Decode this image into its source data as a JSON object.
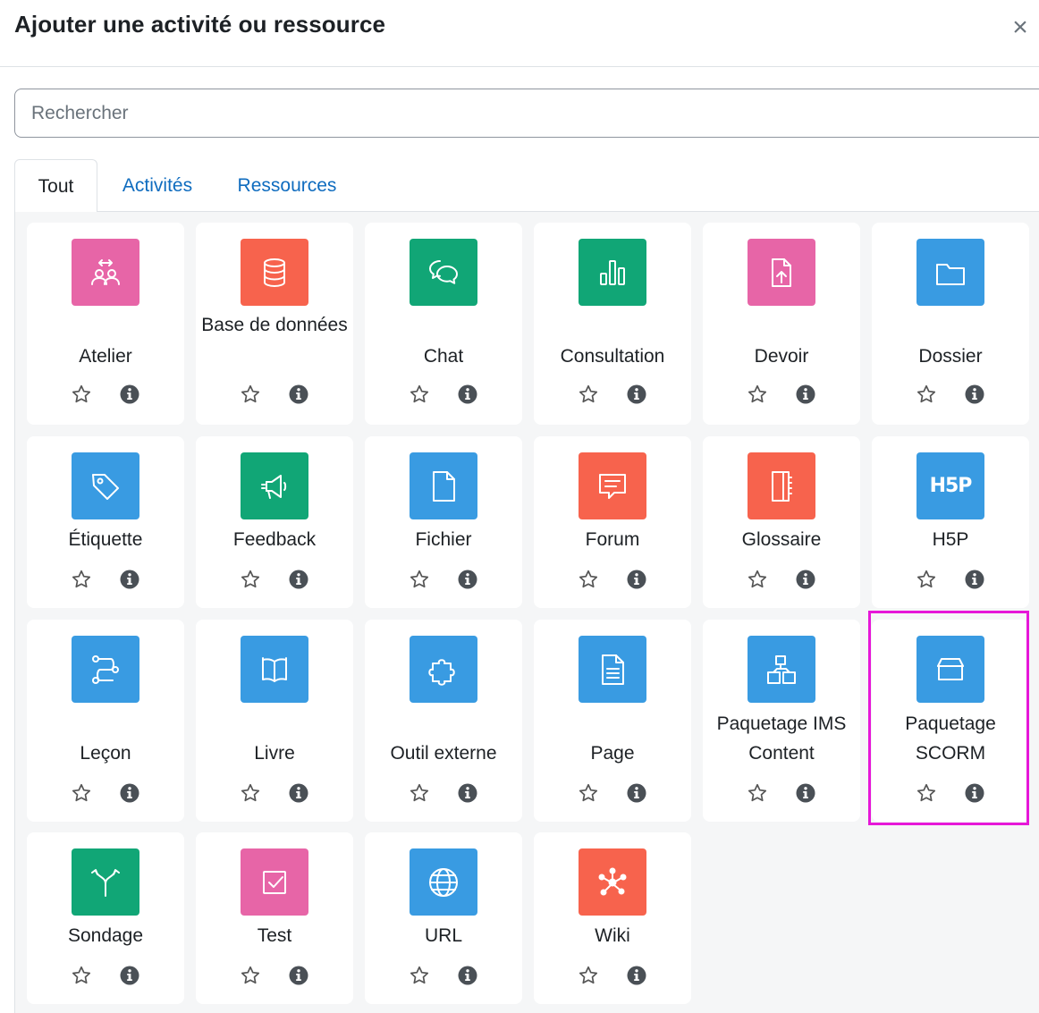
{
  "modal": {
    "title": "Ajouter une activité ou ressource",
    "close_label": "×"
  },
  "search": {
    "placeholder": "Rechercher",
    "value": ""
  },
  "tabs": [
    {
      "label": "Tout",
      "active": true
    },
    {
      "label": "Activités",
      "active": false
    },
    {
      "label": "Ressources",
      "active": false
    }
  ],
  "colors": {
    "pink": "#e765a7",
    "orange": "#f7634d",
    "green": "#11a676",
    "blue": "#399be2",
    "link": "#0f6cbf",
    "highlight": "#e617d8"
  },
  "items": [
    {
      "label": "Atelier",
      "icon": "workshop-icon",
      "color": "#e765a7"
    },
    {
      "label": "Base de données",
      "icon": "database-icon",
      "color": "#f7634d"
    },
    {
      "label": "Chat",
      "icon": "chat-icon",
      "color": "#11a676"
    },
    {
      "label": "Consultation",
      "icon": "bar-chart-icon",
      "color": "#11a676"
    },
    {
      "label": "Devoir",
      "icon": "file-upload-icon",
      "color": "#e765a7"
    },
    {
      "label": "Dossier",
      "icon": "folder-icon",
      "color": "#399be2"
    },
    {
      "label": "Étiquette",
      "icon": "tag-icon",
      "color": "#399be2"
    },
    {
      "label": "Feedback",
      "icon": "megaphone-icon",
      "color": "#11a676"
    },
    {
      "label": "Fichier",
      "icon": "file-icon",
      "color": "#399be2"
    },
    {
      "label": "Forum",
      "icon": "forum-icon",
      "color": "#f7634d"
    },
    {
      "label": "Glossaire",
      "icon": "glossary-icon",
      "color": "#f7634d"
    },
    {
      "label": "H5P",
      "icon": "h5p-icon",
      "color": "#399be2",
      "icon_text": "H5P"
    },
    {
      "label": "Leçon",
      "icon": "lesson-icon",
      "color": "#399be2"
    },
    {
      "label": "Livre",
      "icon": "book-icon",
      "color": "#399be2"
    },
    {
      "label": "Outil externe",
      "icon": "puzzle-icon",
      "color": "#399be2"
    },
    {
      "label": "Page",
      "icon": "page-icon",
      "color": "#399be2"
    },
    {
      "label": "Paquetage IMS Content",
      "icon": "ims-package-icon",
      "color": "#399be2"
    },
    {
      "label": "Paquetage SCORM",
      "icon": "scorm-package-icon",
      "color": "#399be2",
      "highlighted": true
    },
    {
      "label": "Sondage",
      "icon": "choice-icon",
      "color": "#11a676"
    },
    {
      "label": "Test",
      "icon": "checkbox-icon",
      "color": "#e765a7"
    },
    {
      "label": "URL",
      "icon": "globe-icon",
      "color": "#399be2"
    },
    {
      "label": "Wiki",
      "icon": "wiki-icon",
      "color": "#f7634d"
    }
  ]
}
